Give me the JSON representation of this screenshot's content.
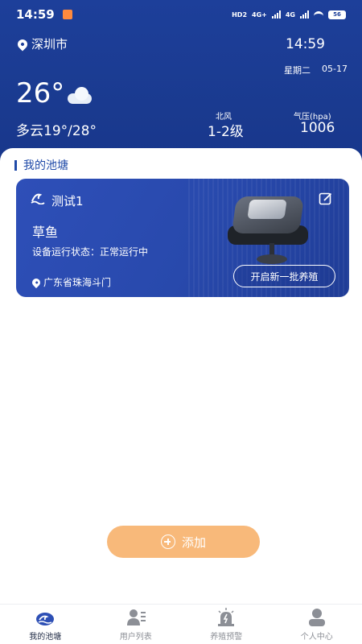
{
  "status_bar": {
    "time": "14:59",
    "right_labels": [
      "HD2",
      "4G+",
      "4G"
    ],
    "battery": "56"
  },
  "weather": {
    "location": "深圳市",
    "clock": "14:59",
    "weekday": "星期二",
    "date": "05-17",
    "temperature": "26°",
    "condition": "多云19°/28°",
    "wind_label": "北风",
    "wind_value": "1-2级",
    "pressure_label": "气压(hpa)",
    "pressure_value": "1006",
    "weather_icon": "cloud-icon"
  },
  "section": {
    "title": "我的池塘"
  },
  "pond_card": {
    "name": "测试1",
    "fish": "草鱼",
    "status": "设备运行状态：正常运行中",
    "address": "广东省珠海斗门",
    "button": "开启新一批养殖"
  },
  "add_button": {
    "label": "添加"
  },
  "tabs": [
    {
      "label": "我的池塘",
      "icon": "pond-icon",
      "active": true
    },
    {
      "label": "用户列表",
      "icon": "user-list-icon",
      "active": false
    },
    {
      "label": "养殖预警",
      "icon": "alarm-icon",
      "active": false
    },
    {
      "label": "个人中心",
      "icon": "person-icon",
      "active": false
    }
  ],
  "colors": {
    "header": "#1d3f9a",
    "card": "#2849ac",
    "accent": "#1f4aa8",
    "add_button": "#f8b97a"
  }
}
